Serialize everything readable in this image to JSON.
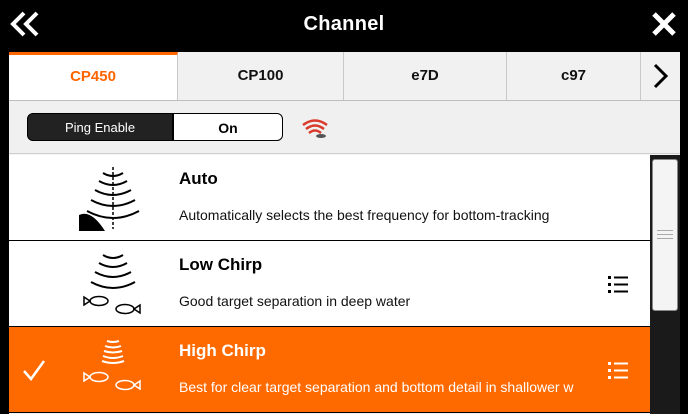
{
  "window": {
    "title": "Channel"
  },
  "tabs": [
    {
      "label": "CP450",
      "active": true
    },
    {
      "label": "CP100",
      "active": false
    },
    {
      "label": "e7D",
      "active": false
    },
    {
      "label": "c97",
      "active": false
    }
  ],
  "ping": {
    "label": "Ping Enable",
    "value": "On"
  },
  "channels": [
    {
      "title": "Auto",
      "description": "Automatically selects the best frequency for bottom-tracking",
      "icon": "auto-sonar-icon",
      "has_menu": false,
      "selected": false
    },
    {
      "title": "Low Chirp",
      "description": "Good target separation in deep water",
      "icon": "low-chirp-fish-icon",
      "has_menu": true,
      "selected": false
    },
    {
      "title": "High Chirp",
      "description": "Best for clear target separation and bottom detail in shallower w",
      "icon": "high-chirp-fish-icon",
      "has_menu": true,
      "selected": true
    }
  ],
  "colors": {
    "accent": "#ff6600",
    "selected_row": "#ff6a00",
    "titlebar": "#000000",
    "ping_icon": "#d93a2b"
  },
  "icons": {
    "back": "double-chevron-left-icon",
    "close": "close-x-icon",
    "next": "chevron-right-icon",
    "sonar": "sonar-ping-icon",
    "check": "checkmark-icon",
    "menu": "list-menu-icon"
  }
}
